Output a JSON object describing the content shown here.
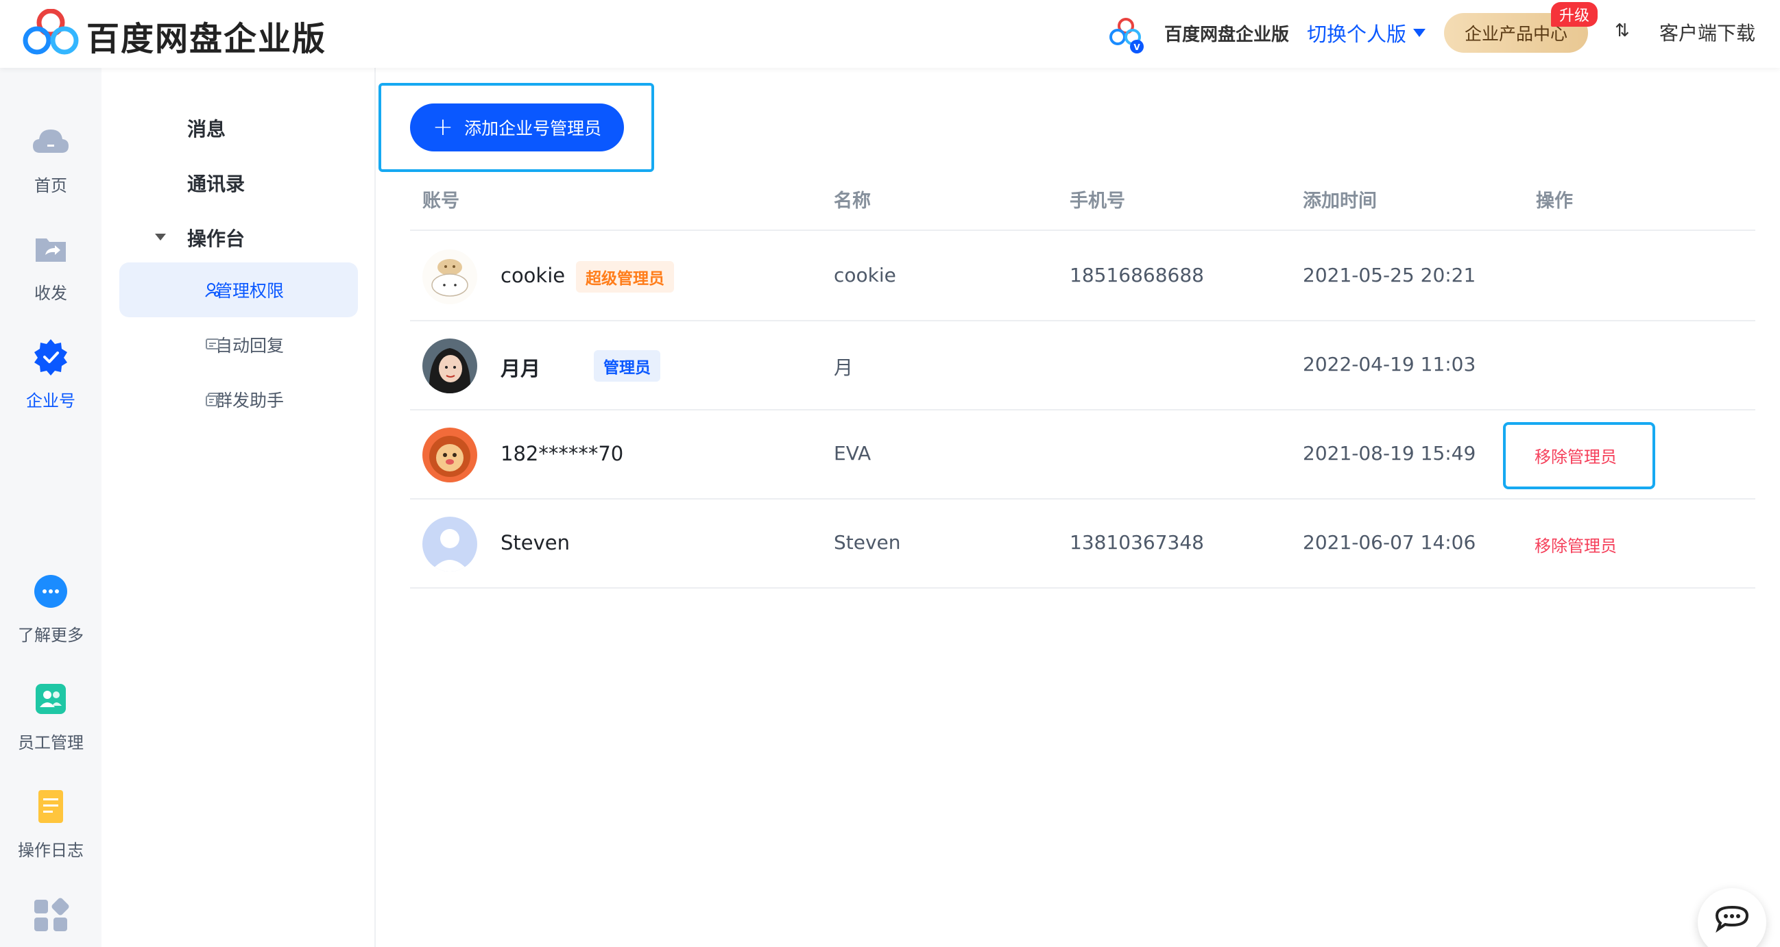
{
  "header": {
    "brand_title": "百度网盘企业版",
    "enterprise_name": "百度网盘企业版",
    "switch_personal": "切换个人版",
    "product_center": "企业产品中心",
    "upgrade_tag": "升级",
    "lang_icon": "⇅",
    "client_download": "客户端下载"
  },
  "rail": {
    "items": [
      {
        "label": "首页",
        "icon": "cloud-icon"
      },
      {
        "label": "收发",
        "icon": "share-folder-icon"
      },
      {
        "label": "企业号",
        "icon": "verified-badge-icon"
      },
      {
        "label": "了解更多",
        "icon": "more-dots-icon"
      },
      {
        "label": "员工管理",
        "icon": "employee-icon"
      },
      {
        "label": "操作日志",
        "icon": "log-document-icon"
      }
    ]
  },
  "subnav": {
    "items": [
      {
        "label": "消息"
      },
      {
        "label": "通讯录"
      },
      {
        "label": "操作台"
      }
    ],
    "subitems": [
      {
        "label": "管理权限",
        "icon": "admin-user-icon"
      },
      {
        "label": "自动回复",
        "icon": "auto-reply-icon"
      },
      {
        "label": "群发助手",
        "icon": "broadcast-icon"
      }
    ]
  },
  "main": {
    "add_button": "添加企业号管理员",
    "columns": [
      "账号",
      "名称",
      "手机号",
      "添加时间",
      "操作"
    ],
    "rows": [
      {
        "account": "cookie",
        "role": "超级管理员",
        "name": "cookie",
        "phone": "18516868688",
        "added": "2021-05-25 20:21",
        "action": ""
      },
      {
        "account": "月月",
        "role": "管理员",
        "name": "月",
        "phone": "",
        "added": "2022-04-19 11:03",
        "action": ""
      },
      {
        "account": "182******70",
        "role": "",
        "name": "EVA",
        "phone": "",
        "added": "2021-08-19 15:49",
        "action": "移除管理员"
      },
      {
        "account": "Steven",
        "role": "",
        "name": "Steven",
        "phone": "13810367348",
        "added": "2021-06-07 14:06",
        "action": "移除管理员"
      }
    ]
  },
  "colors": {
    "accent": "#0a58ff",
    "danger": "#f53f5a",
    "highlight_frame": "#16a9f2"
  }
}
